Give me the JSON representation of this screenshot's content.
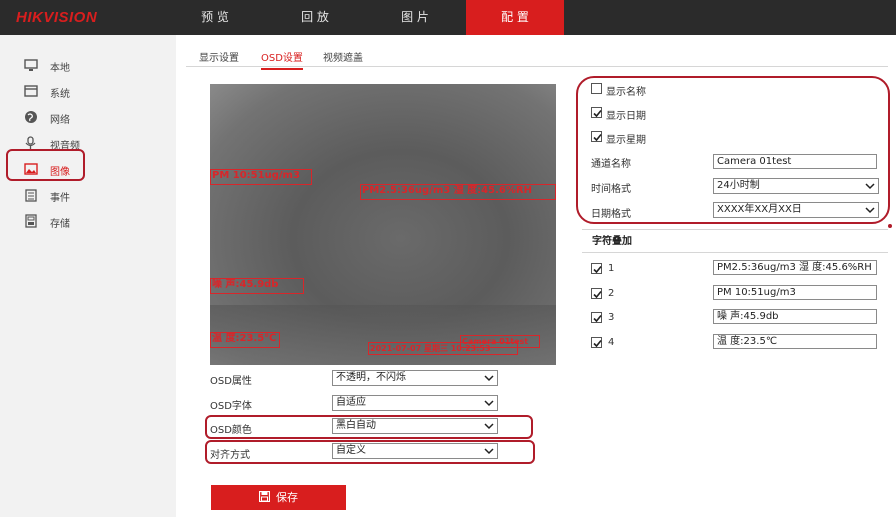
{
  "brand": {
    "logo_text": "HIKVISION"
  },
  "top_nav": [
    {
      "label": "预 览"
    },
    {
      "label": "回 放"
    },
    {
      "label": "图 片"
    },
    {
      "label": "配 置",
      "active": true
    }
  ],
  "sidebar": {
    "items": [
      {
        "label": "本地",
        "icon": "monitor-icon"
      },
      {
        "label": "系统",
        "icon": "system-window-icon"
      },
      {
        "label": "网络",
        "icon": "globe-icon"
      },
      {
        "label": "视音频",
        "icon": "microphone-icon"
      },
      {
        "label": "图像",
        "icon": "image-icon",
        "active": true
      },
      {
        "label": "事件",
        "icon": "calendar-icon"
      },
      {
        "label": "存储",
        "icon": "disk-icon"
      }
    ]
  },
  "tabs": [
    {
      "label": "显示设置"
    },
    {
      "label": "OSD设置",
      "active": true
    },
    {
      "label": "视频遮盖"
    }
  ],
  "video_overlays": {
    "overlay_1": "PM 10:51ug/m3",
    "overlay_2": "PM2.5:36ug/m3 湿 度:45.6%RH",
    "overlay_3": "噪 声:45.9db",
    "overlay_4": "温 度:23.5℃",
    "overlay_5": "Camera 01test",
    "overlay_6": "2021-07-07 星期三 10:23:53"
  },
  "osd_form": {
    "attr_label": "OSD属性",
    "attr_value": "不透明，不闪烁",
    "font_label": "OSD字体",
    "font_value": "自适应",
    "color_label": "OSD颜色",
    "color_value": "黑白自动",
    "align_label": "对齐方式",
    "align_value": "自定义"
  },
  "save_button": {
    "label": "保存"
  },
  "display": {
    "show_name": "显示名称",
    "show_name_checked": false,
    "show_date": "显示日期",
    "show_date_checked": true,
    "show_week": "显示星期",
    "show_week_checked": true,
    "channel_name_label": "通道名称",
    "channel_name_value": "Camera 01test",
    "time_format_label": "时间格式",
    "time_format_value": "24小时制",
    "date_format_label": "日期格式",
    "date_format_value": "XXXX年XX月XX日"
  },
  "char_overlay": {
    "title": "字符叠加",
    "rows": [
      {
        "num": "1",
        "checked": true,
        "value": "PM2.5:36ug/m3 湿 度:45.6%RH"
      },
      {
        "num": "2",
        "checked": true,
        "value": "PM 10:51ug/m3"
      },
      {
        "num": "3",
        "checked": true,
        "value": "噪 声:45.9db"
      },
      {
        "num": "4",
        "checked": true,
        "value": "温 度:23.5℃"
      }
    ]
  },
  "colors": {
    "accent": "#d81e1e",
    "topbar": "#2b2b2b",
    "highlight": "#b01c2a"
  }
}
